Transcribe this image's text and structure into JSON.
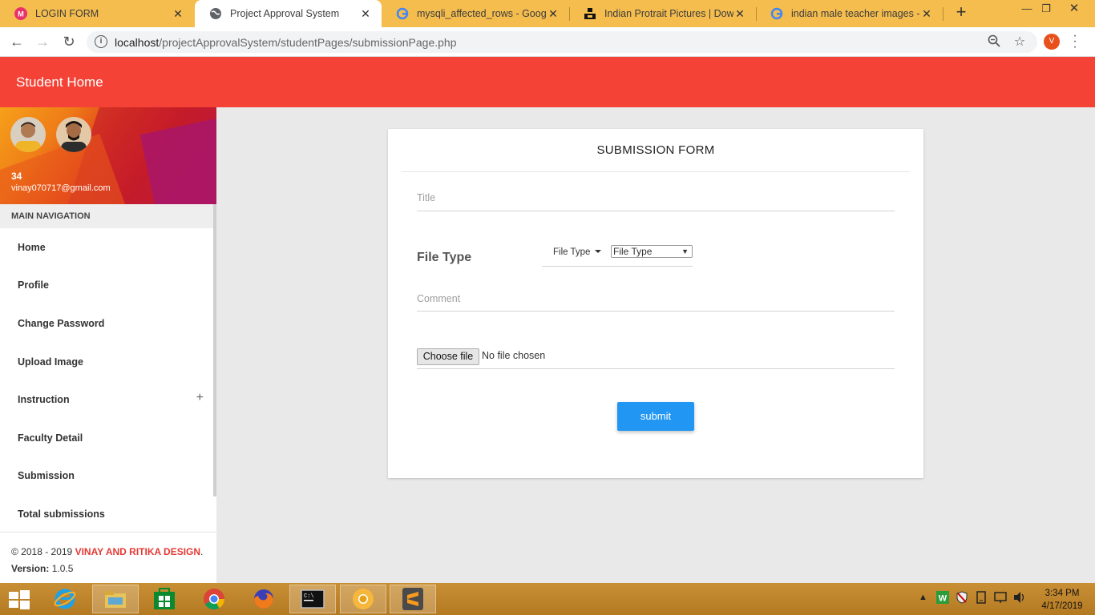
{
  "browser": {
    "tabs": [
      {
        "title": "LOGIN FORM",
        "icon": "m-logo-icon"
      },
      {
        "title": "Project Approval System",
        "icon": "globe-icon"
      },
      {
        "title": "mysqli_affected_rows - Google S",
        "icon": "google-icon"
      },
      {
        "title": "Indian Protrait Pictures | Downlo",
        "icon": "unsplash-icon"
      },
      {
        "title": "indian male teacher images - Go",
        "icon": "google-icon"
      }
    ],
    "new_tab": "+",
    "url_host": "localhost",
    "url_path": "/projectApprovalSystem/studentPages/submissionPage.php",
    "profile_initial": "V"
  },
  "header": {
    "title": "Student Home"
  },
  "user": {
    "name": "34",
    "email": "vinay070717@gmail.com"
  },
  "sidebar": {
    "nav_header": "MAIN NAVIGATION",
    "items": [
      {
        "label": "Home"
      },
      {
        "label": "Profile"
      },
      {
        "label": "Change Password"
      },
      {
        "label": "Upload Image"
      },
      {
        "label": "Instruction",
        "expand": "+"
      },
      {
        "label": "Faculty Detail"
      },
      {
        "label": "Submission"
      },
      {
        "label": "Total submissions"
      }
    ],
    "copyright_prefix": "© 2018 - 2019 ",
    "copyright_brand": "VINAY AND RITIKA DESIGN",
    "copyright_suffix": ".",
    "version_label": "Version:",
    "version_value": " 1.0.5"
  },
  "form": {
    "title": "SUBMISSION FORM",
    "title_placeholder": "Title",
    "file_type_label": "File Type",
    "file_type_dropdown": "File Type",
    "file_type_select": "File Type",
    "comment_placeholder": "Comment",
    "choose_file": "Choose file",
    "no_file": "No file chosen",
    "submit": "submit"
  },
  "taskbar": {
    "time": "3:34 PM",
    "date": "4/17/2019"
  },
  "colors": {
    "header": "#f44336",
    "submit": "#2196f3",
    "brand_text": "#e53935",
    "tabbar": "#f5bd4e"
  }
}
